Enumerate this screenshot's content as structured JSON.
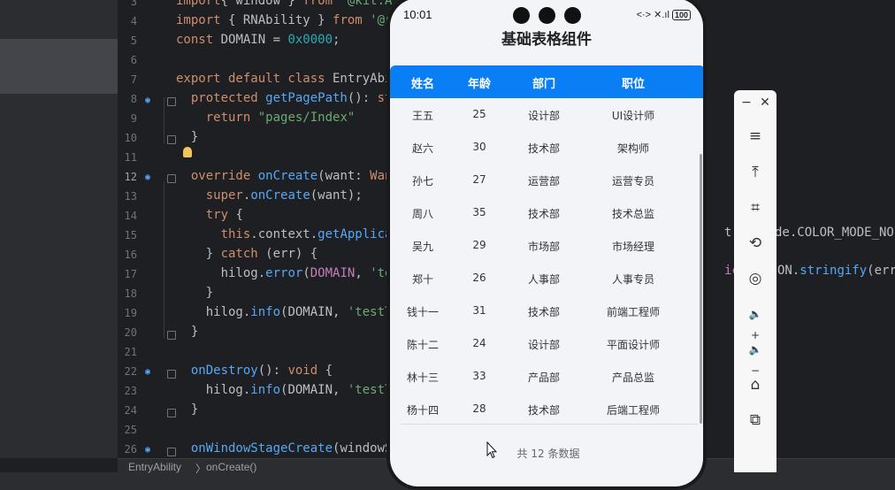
{
  "ide": {
    "code_lines": [
      {
        "n": "3",
        "tokens": [
          [
            "kw",
            "import"
          ],
          [
            "",
            "{ window } "
          ],
          [
            "kw",
            "from"
          ],
          [
            "str",
            " '@kit.A"
          ]
        ]
      },
      {
        "n": "4",
        "tokens": [
          [
            "kw",
            "import"
          ],
          [
            "",
            " { RNAbility } "
          ],
          [
            "kw",
            "from"
          ],
          [
            "str",
            " '@rn"
          ]
        ]
      },
      {
        "n": "5",
        "tokens": [
          [
            "kw",
            "const"
          ],
          [
            "",
            " DOMAIN = "
          ],
          [
            "num",
            "0x0000"
          ],
          [
            "",
            ";"
          ]
        ]
      },
      {
        "n": "6",
        "tokens": []
      },
      {
        "n": "7",
        "tokens": [
          [
            "kw",
            "export default class"
          ],
          [
            "",
            " EntryAbi"
          ]
        ]
      },
      {
        "n": "8",
        "tokens": [
          [
            "",
            "  "
          ],
          [
            "kw",
            "protected"
          ],
          [
            "fn",
            " getPagePath"
          ],
          [
            "",
            "(): "
          ],
          [
            "kw",
            "st"
          ]
        ]
      },
      {
        "n": "9",
        "tokens": [
          [
            "",
            "    "
          ],
          [
            "kw",
            "return"
          ],
          [
            "str",
            " \"pages/Index\""
          ]
        ]
      },
      {
        "n": "10",
        "tokens": [
          [
            "",
            "  }"
          ]
        ]
      },
      {
        "n": "11",
        "tokens": []
      },
      {
        "n": "12",
        "tokens": [
          [
            "",
            "  "
          ],
          [
            "kw",
            "override"
          ],
          [
            "fn",
            " onCreate"
          ],
          [
            "",
            "(want: "
          ],
          [
            "kw",
            "Want"
          ]
        ]
      },
      {
        "n": "13",
        "tokens": [
          [
            "",
            "    "
          ],
          [
            "kw",
            "super"
          ],
          [
            "",
            "."
          ],
          [
            "fn",
            "onCreate"
          ],
          [
            "",
            "(want);"
          ]
        ]
      },
      {
        "n": "14",
        "tokens": [
          [
            "",
            "    "
          ],
          [
            "kw",
            "try"
          ],
          [
            "",
            " {"
          ]
        ]
      },
      {
        "n": "15",
        "tokens": [
          [
            "",
            "      "
          ],
          [
            "kw",
            "this"
          ],
          [
            "",
            ".context."
          ],
          [
            "fn",
            "getApplicat"
          ]
        ]
      },
      {
        "n": "16",
        "tokens": [
          [
            "",
            "    } "
          ],
          [
            "kw",
            "catch"
          ],
          [
            "",
            " (err) {"
          ]
        ]
      },
      {
        "n": "17",
        "tokens": [
          [
            "",
            "      hilog."
          ],
          [
            "fn",
            "error"
          ],
          [
            "",
            "("
          ],
          [
            "tp",
            "DOMAIN"
          ],
          [
            "",
            ", "
          ],
          [
            "str",
            "'tes"
          ]
        ]
      },
      {
        "n": "18",
        "tokens": [
          [
            "",
            "    }"
          ]
        ]
      },
      {
        "n": "19",
        "tokens": [
          [
            "",
            "    hilog."
          ],
          [
            "fn",
            "info"
          ],
          [
            "",
            "(DOMAIN, "
          ],
          [
            "str",
            "'testTa"
          ]
        ]
      },
      {
        "n": "20",
        "tokens": [
          [
            "",
            "  }"
          ]
        ]
      },
      {
        "n": "21",
        "tokens": []
      },
      {
        "n": "22",
        "tokens": [
          [
            "",
            "  "
          ],
          [
            "fn",
            "onDestroy"
          ],
          [
            "",
            "(): "
          ],
          [
            "kw",
            "void"
          ],
          [
            "",
            " {"
          ]
        ]
      },
      {
        "n": "23",
        "tokens": [
          [
            "",
            "    hilog."
          ],
          [
            "fn",
            "info"
          ],
          [
            "",
            "(DOMAIN, "
          ],
          [
            "str",
            "'testTa"
          ]
        ]
      },
      {
        "n": "24",
        "tokens": [
          [
            "",
            "  }"
          ]
        ]
      },
      {
        "n": "25",
        "tokens": []
      },
      {
        "n": "26",
        "tokens": [
          [
            "",
            "  "
          ],
          [
            "fn",
            "onWindowStageCreate"
          ],
          [
            "",
            "(windowS"
          ]
        ]
      }
    ],
    "right_fragments": {
      "line15": "t.C",
      "line15b": "de.COLOR_MODE_NO",
      "line17": "ic}",
      "line17b": "ON.",
      "line17c": "stringify",
      "line17d": "(err"
    },
    "statusbar": {
      "crumb1": "EntryAbility",
      "sep": "〉",
      "crumb2": "onCreate()"
    }
  },
  "phone": {
    "status_time": "10:01",
    "status_icons": "<·> ✕.ıl",
    "battery": "100",
    "title": "基础表格组件",
    "headers": [
      "姓名",
      "年龄",
      "部门",
      "职位"
    ],
    "rows": [
      [
        "王五",
        "25",
        "设计部",
        "UI设计师"
      ],
      [
        "赵六",
        "30",
        "技术部",
        "架构师"
      ],
      [
        "孙七",
        "27",
        "运营部",
        "运营专员"
      ],
      [
        "周八",
        "35",
        "技术部",
        "技术总监"
      ],
      [
        "吴九",
        "29",
        "市场部",
        "市场经理"
      ],
      [
        "郑十",
        "26",
        "人事部",
        "人事专员"
      ],
      [
        "钱十一",
        "31",
        "技术部",
        "前端工程师"
      ],
      [
        "陈十二",
        "24",
        "设计部",
        "平面设计师"
      ],
      [
        "林十三",
        "33",
        "产品部",
        "产品总监"
      ],
      [
        "杨十四",
        "28",
        "技术部",
        "后端工程师"
      ]
    ],
    "footer": "共 12 条数据"
  },
  "toolbar": {
    "minimize": "−",
    "close": "✕",
    "buttons": [
      {
        "icon": "menu-icon",
        "glyph": "≡"
      },
      {
        "icon": "pin-top-icon",
        "glyph": "⤒"
      },
      {
        "icon": "crop-icon",
        "glyph": "⌗"
      },
      {
        "icon": "rotate-icon",
        "glyph": "⟲"
      },
      {
        "icon": "screenshot-icon",
        "glyph": "◎"
      },
      {
        "icon": "volume-up-icon",
        "glyph": "🔈+"
      },
      {
        "icon": "volume-down-icon",
        "glyph": "🔈−"
      },
      {
        "icon": "shake-icon",
        "glyph": "⌂"
      },
      {
        "icon": "switch-device-icon",
        "glyph": "⧉"
      }
    ]
  }
}
